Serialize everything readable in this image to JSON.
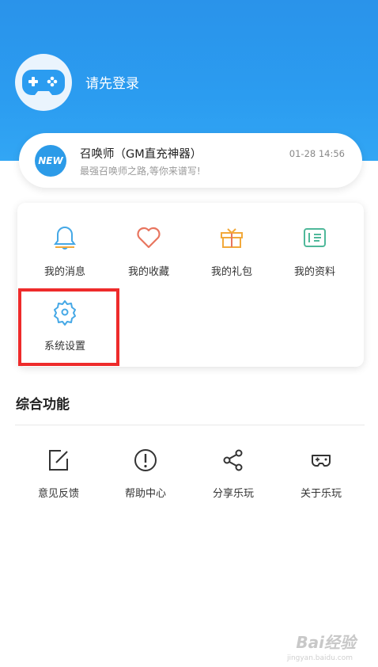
{
  "profile": {
    "login_prompt": "请先登录",
    "avatar_icon": "gamepad-icon"
  },
  "notice": {
    "badge": "NEW",
    "title": "召唤师（GM直充神器）",
    "subtitle": "最强召唤师之路,等你来谱写!",
    "time": "01-28 14:56"
  },
  "personal_menu": [
    {
      "label": "我的消息",
      "icon": "bell-icon",
      "color": "#45a8e6"
    },
    {
      "label": "我的收藏",
      "icon": "heart-icon",
      "color": "#e8755f"
    },
    {
      "label": "我的礼包",
      "icon": "gift-icon",
      "color": "#f2a93b"
    },
    {
      "label": "我的资料",
      "icon": "profile-card-icon",
      "color": "#4fb89a"
    },
    {
      "label": "系统设置",
      "icon": "gear-icon",
      "color": "#45a8e6"
    }
  ],
  "section": {
    "title": "综合功能"
  },
  "functions": [
    {
      "label": "意见反馈",
      "icon": "edit-icon"
    },
    {
      "label": "帮助中心",
      "icon": "help-icon"
    },
    {
      "label": "分享乐玩",
      "icon": "share-icon"
    },
    {
      "label": "关于乐玩",
      "icon": "gamepad-icon"
    }
  ],
  "watermark": {
    "text": "Bai经验",
    "sub": "jingyan.baidu.com"
  },
  "colors": {
    "header": "#2b9cf0",
    "highlight": "#ee2b2b"
  }
}
